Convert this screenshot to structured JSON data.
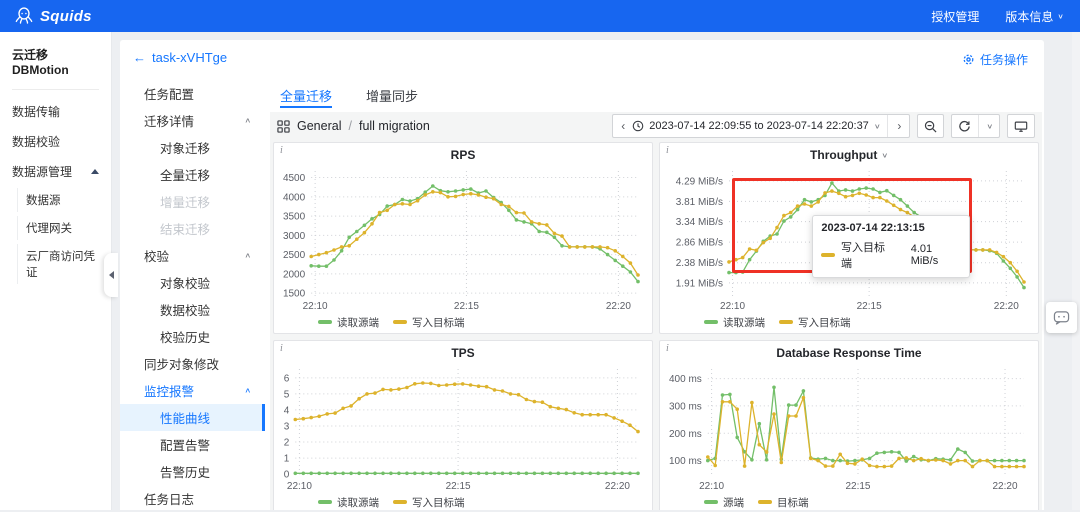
{
  "colors": {
    "topbar": "#1766f0",
    "accent": "#1677ff",
    "series_green": "#73bf69",
    "series_yellow": "#ddb32c",
    "annotation_red": "#ef3125"
  },
  "topbar": {
    "logo_text": "Squids",
    "links": [
      {
        "label": "授权管理"
      },
      {
        "label": "版本信息"
      }
    ]
  },
  "sidebar": {
    "title": "云迁移 DBMotion",
    "items": [
      {
        "label": "数据传输",
        "level": 0
      },
      {
        "label": "数据校验",
        "level": 0
      },
      {
        "label": "数据源管理",
        "level": 0,
        "caret": true
      },
      {
        "label": "数据源",
        "level": 1
      },
      {
        "label": "代理网关",
        "level": 1
      },
      {
        "label": "云厂商访问凭证",
        "level": 1
      }
    ]
  },
  "tasknav": {
    "back_label": "task-xVHTge",
    "back_arrow": "←",
    "actions_label": "任务操作",
    "items": [
      {
        "label": "任务配置",
        "level": 0
      },
      {
        "label": "迁移详情",
        "level": 0,
        "caret": true
      },
      {
        "label": "对象迁移",
        "level": 1
      },
      {
        "label": "全量迁移",
        "level": 1
      },
      {
        "label": "增量迁移",
        "level": 1,
        "disabled": true
      },
      {
        "label": "结束迁移",
        "level": 1,
        "disabled": true
      },
      {
        "label": "校验",
        "level": 0,
        "caret": true
      },
      {
        "label": "对象校验",
        "level": 1
      },
      {
        "label": "数据校验",
        "level": 1
      },
      {
        "label": "校验历史",
        "level": 1
      },
      {
        "label": "同步对象修改",
        "level": 0
      },
      {
        "label": "监控报警",
        "level": 0,
        "caret": true,
        "highlight": true
      },
      {
        "label": "性能曲线",
        "level": 1,
        "active": true
      },
      {
        "label": "配置告警",
        "level": 1
      },
      {
        "label": "告警历史",
        "level": 1
      },
      {
        "label": "任务日志",
        "level": 0
      }
    ]
  },
  "tabs": [
    {
      "label": "全量迁移",
      "active": true
    },
    {
      "label": "增量同步",
      "active": false
    }
  ],
  "dashboard": {
    "breadcrumb_section": "General",
    "breadcrumb_sep": "/",
    "breadcrumb_page": "full migration",
    "time_range": "2023-07-14 22:09:55 to 2023-07-14 22:20:37",
    "prev_arrow": "‹",
    "next_arrow": "›"
  },
  "throughput_overlay": {
    "tooltip_time": "2023-07-14 22:13:15",
    "tooltip_series": "写入目标端",
    "tooltip_value": "4.01 MiB/s"
  },
  "chart_data": [
    {
      "type": "line",
      "title": "RPS",
      "ylim": [
        1400,
        4670
      ],
      "yticks": [
        {
          "v": 1500,
          "label": "1500"
        },
        {
          "v": 2000,
          "label": "2000"
        },
        {
          "v": 2500,
          "label": "2500"
        },
        {
          "v": 3000,
          "label": "3000"
        },
        {
          "v": 3500,
          "label": "3500"
        },
        {
          "v": 4000,
          "label": "4000"
        },
        {
          "v": 4500,
          "label": "4500"
        }
      ],
      "xticks": [
        {
          "frac": 0.012,
          "label": "22:10"
        },
        {
          "frac": 0.475,
          "label": "22:15"
        },
        {
          "frac": 0.94,
          "label": "22:20"
        }
      ],
      "series": [
        {
          "name": "读取源端",
          "color": "#73bf69",
          "values": [
            2210,
            2200,
            2200,
            2360,
            2600,
            2950,
            3100,
            3260,
            3430,
            3540,
            3760,
            3800,
            3930,
            3890,
            3950,
            4120,
            4280,
            4160,
            4130,
            4150,
            4180,
            4200,
            4100,
            4150,
            3980,
            3850,
            3650,
            3400,
            3350,
            3300,
            3100,
            3080,
            2950,
            2730,
            2700,
            2700,
            2700,
            2700,
            2650,
            2500,
            2350,
            2200,
            2050,
            1800
          ]
        },
        {
          "name": "写入目标端",
          "color": "#ddb32c",
          "values": [
            2450,
            2500,
            2550,
            2620,
            2700,
            2730,
            2900,
            3070,
            3300,
            3590,
            3650,
            3800,
            3820,
            3800,
            3900,
            4050,
            4130,
            4110,
            4000,
            4010,
            4060,
            4080,
            4050,
            3990,
            3950,
            3800,
            3750,
            3590,
            3580,
            3350,
            3300,
            3270,
            3050,
            2980,
            2700,
            2700,
            2700,
            2700,
            2700,
            2680,
            2600,
            2450,
            2280,
            1970
          ]
        }
      ]
    },
    {
      "type": "line",
      "title": "Throughput",
      "title_caret": true,
      "ylim": [
        1.58,
        4.52
      ],
      "yticks": [
        {
          "v": 1.91,
          "label": "1.91 MiB/s"
        },
        {
          "v": 2.38,
          "label": "2.38 MiB/s"
        },
        {
          "v": 2.86,
          "label": "2.86 MiB/s"
        },
        {
          "v": 3.34,
          "label": "3.34 MiB/s"
        },
        {
          "v": 3.81,
          "label": "3.81 MiB/s"
        },
        {
          "v": 4.29,
          "label": "4.29 MiB/s"
        }
      ],
      "xticks": [
        {
          "frac": 0.012,
          "label": "22:10"
        },
        {
          "frac": 0.475,
          "label": "22:15"
        },
        {
          "frac": 0.94,
          "label": "22:20"
        }
      ],
      "series": [
        {
          "name": "读取源端",
          "color": "#73bf69",
          "values": [
            2.15,
            2.15,
            2.16,
            2.45,
            2.65,
            2.88,
            3.0,
            3.05,
            3.35,
            3.45,
            3.62,
            3.85,
            3.8,
            3.85,
            3.95,
            4.24,
            4.05,
            4.08,
            4.05,
            4.1,
            4.12,
            4.1,
            4.02,
            4.06,
            3.95,
            3.85,
            3.7,
            3.55,
            3.45,
            3.28,
            3.05,
            3.0,
            2.95,
            2.78,
            2.68,
            2.68,
            2.68,
            2.68,
            2.66,
            2.6,
            2.42,
            2.25,
            2.05,
            1.8
          ]
        },
        {
          "name": "写入目标端",
          "color": "#ddb32c",
          "values": [
            2.4,
            2.45,
            2.5,
            2.7,
            2.67,
            2.85,
            2.95,
            3.2,
            3.48,
            3.55,
            3.7,
            3.75,
            3.7,
            3.8,
            4.01,
            4.05,
            4.0,
            3.92,
            3.95,
            4.0,
            3.96,
            3.9,
            3.9,
            3.82,
            3.72,
            3.62,
            3.55,
            3.45,
            3.3,
            3.1,
            3.0,
            2.95,
            2.8,
            2.7,
            2.68,
            2.68,
            2.68,
            2.68,
            2.68,
            2.62,
            2.52,
            2.38,
            2.18,
            1.93
          ]
        }
      ]
    },
    {
      "type": "line",
      "title": "TPS",
      "ylim": [
        -0.18,
        6.55
      ],
      "yticks": [
        {
          "v": 0,
          "label": "0"
        },
        {
          "v": 1,
          "label": "1"
        },
        {
          "v": 2,
          "label": "2"
        },
        {
          "v": 3,
          "label": "3"
        },
        {
          "v": 4,
          "label": "4"
        },
        {
          "v": 5,
          "label": "5"
        },
        {
          "v": 6,
          "label": "6"
        }
      ],
      "xticks": [
        {
          "frac": 0.012,
          "label": "22:10"
        },
        {
          "frac": 0.475,
          "label": "22:15"
        },
        {
          "frac": 0.94,
          "label": "22:20"
        }
      ],
      "series": [
        {
          "name": "读取源端",
          "color": "#73bf69",
          "values": [
            0.05,
            0.05,
            0.05,
            0.05,
            0.05,
            0.05,
            0.05,
            0.05,
            0.05,
            0.05,
            0.05,
            0.05,
            0.05,
            0.05,
            0.05,
            0.05,
            0.05,
            0.05,
            0.05,
            0.05,
            0.05,
            0.05,
            0.05,
            0.05,
            0.05,
            0.05,
            0.05,
            0.05,
            0.05,
            0.05,
            0.05,
            0.05,
            0.05,
            0.05,
            0.05,
            0.05,
            0.05,
            0.05,
            0.05,
            0.05,
            0.05,
            0.05,
            0.05,
            0.05
          ]
        },
        {
          "name": "写入目标端",
          "color": "#ddb32c",
          "values": [
            3.4,
            3.45,
            3.52,
            3.6,
            3.75,
            3.8,
            4.1,
            4.25,
            4.7,
            5.0,
            5.05,
            5.28,
            5.25,
            5.3,
            5.4,
            5.63,
            5.68,
            5.65,
            5.52,
            5.55,
            5.6,
            5.62,
            5.55,
            5.48,
            5.45,
            5.25,
            5.18,
            5.0,
            4.95,
            4.65,
            4.52,
            4.48,
            4.2,
            4.1,
            4.02,
            3.82,
            3.7,
            3.7,
            3.7,
            3.7,
            3.5,
            3.3,
            3.05,
            2.65
          ]
        }
      ]
    },
    {
      "type": "line",
      "title": "Database Response Time",
      "ylim": [
        40,
        435
      ],
      "yticks": [
        {
          "v": 100,
          "label": "100 ms"
        },
        {
          "v": 200,
          "label": "200 ms"
        },
        {
          "v": 300,
          "label": "300 ms"
        },
        {
          "v": 400,
          "label": "400 ms"
        }
      ],
      "xticks": [
        {
          "frac": 0.012,
          "label": "22:10"
        },
        {
          "frac": 0.475,
          "label": "22:15"
        },
        {
          "frac": 0.94,
          "label": "22:20"
        }
      ],
      "series": [
        {
          "name": "源端",
          "color": "#73bf69",
          "values": [
            100,
            108,
            340,
            342,
            185,
            132,
            103,
            235,
            103,
            368,
            105,
            303,
            303,
            355,
            110,
            105,
            108,
            100,
            100,
            98,
            100,
            103,
            108,
            127,
            130,
            132,
            130,
            98,
            115,
            103,
            100,
            107,
            105,
            103,
            142,
            130,
            98,
            100,
            100,
            100,
            100,
            100,
            100,
            100
          ]
        },
        {
          "name": "目标端",
          "color": "#ddb32c",
          "values": [
            113,
            82,
            315,
            315,
            288,
            80,
            312,
            158,
            131,
            270,
            93,
            263,
            263,
            330,
            108,
            100,
            80,
            80,
            123,
            90,
            88,
            105,
            82,
            78,
            78,
            80,
            108,
            110,
            100,
            107,
            100,
            102,
            100,
            88,
            100,
            100,
            78,
            100,
            100,
            78,
            78,
            78,
            78,
            78
          ]
        }
      ]
    }
  ]
}
